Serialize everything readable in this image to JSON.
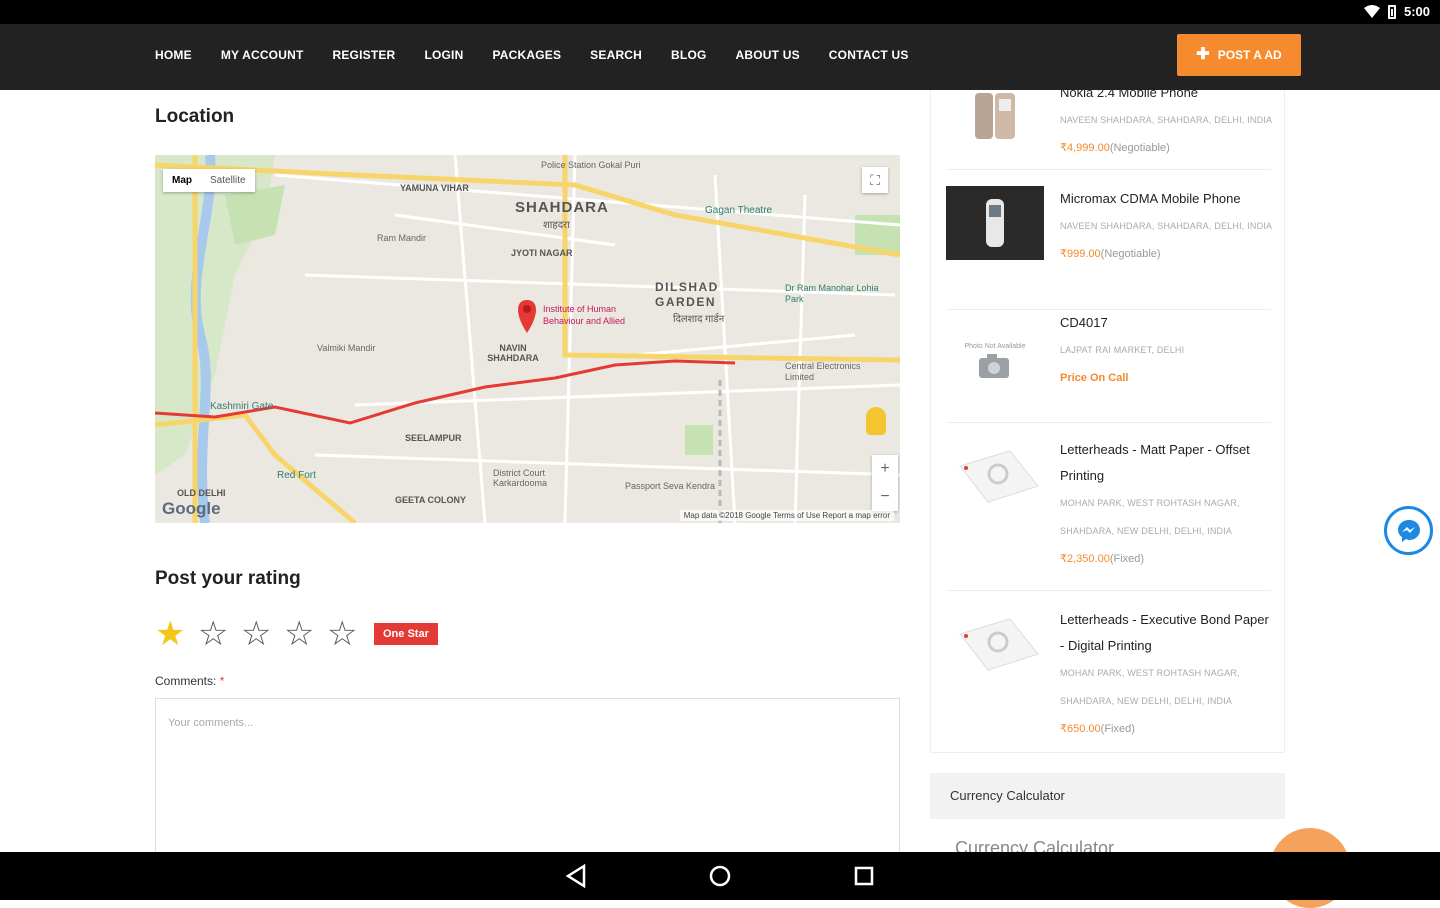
{
  "status_bar": {
    "time": "5:00"
  },
  "navbar": {
    "links": [
      "HOME",
      "MY ACCOUNT",
      "REGISTER",
      "LOGIN",
      "PACKAGES",
      "SEARCH",
      "BLOG",
      "ABOUT US",
      "CONTACT US"
    ],
    "post_ad_label": "POST A AD"
  },
  "location": {
    "title": "Location",
    "map": {
      "type_map": "Map",
      "type_satellite": "Satellite",
      "logo": "Google",
      "credit": "Map data ©2018 Google   Terms of Use   Report a map error",
      "labels": {
        "shahdara": "SHAHDARA",
        "shahdara_hi": "शाहदरा",
        "yamuna_vihar": "YAMUNA VIHAR",
        "dilshad_garden": "DILSHAD GARDEN",
        "dilshad_hi": "दिलशाद गार्डन",
        "jyoti_nagar": "JYOTI NAGAR",
        "navin_shahdara": "NAVIN SHAHDARA",
        "seelampur": "SEELAMPUR",
        "geeta_colony": "GEETA COLONY",
        "old_delhi": "OLD DELHI",
        "red_fort": "Red Fort",
        "kashmiri_gate": "Kashmiri Gate",
        "gagan_theatre": "Gagan Theatre",
        "passport": "Passport Seva Kendra",
        "district_court": "District Court Karkardooma",
        "ram_mandir": "Ram Mandir",
        "valmiki": "Valmiki Mandir",
        "police": "Police Station Gokal Puri",
        "human_behaviour": "Institute of Human Behaviour and Allied",
        "ram_manohar": "Dr Ram Manohar Lohia Park",
        "central_electronics": "Central Electronics Limited"
      }
    }
  },
  "rating": {
    "title": "Post your rating",
    "stars_total": 5,
    "stars_selected": 1,
    "badge": "One Star",
    "comments_label": "Comments:",
    "required_mark": "*",
    "comments_placeholder": "Your comments..."
  },
  "sidebar": {
    "items": [
      {
        "title": "Nokia 2.4 Mobile Phone",
        "location": "NAVEEN SHAHDARA, SHAHDARA, DELHI, INDIA",
        "price": "₹4,999.00",
        "price_note": "(Negotiable)"
      },
      {
        "title": "Micromax CDMA Mobile Phone",
        "location": "NAVEEN SHAHDARA, SHAHDARA, DELHI, INDIA",
        "price": "₹999.00",
        "price_note": "(Negotiable)"
      },
      {
        "title": "CD4017",
        "location": "LAJPAT RAI MARKET, DELHI",
        "price": "Price On Call",
        "price_note": "",
        "thumb_text": "Photo Not Available"
      },
      {
        "title": "Letterheads - Matt Paper - Offset Printing",
        "location": "MOHAN PARK, WEST ROHTASH NAGAR, SHAHDARA, NEW DELHI, DELHI, INDIA",
        "price": "₹2,350.00",
        "price_note": "(Fixed)"
      },
      {
        "title": "Letterheads - Executive Bond Paper - Digital Printing",
        "location": "MOHAN PARK, WEST ROHTASH NAGAR, SHAHDARA, NEW DELHI, DELHI, INDIA",
        "price": "₹650.00",
        "price_note": "(Fixed)"
      }
    ],
    "widget_title": "Currency Calculator",
    "widget_subtitle": "Currency Calculator"
  },
  "colors": {
    "accent": "#f58a2e",
    "navbar": "#222222",
    "badge": "#e53935",
    "star": "#f5c518",
    "route": "#e53935"
  }
}
